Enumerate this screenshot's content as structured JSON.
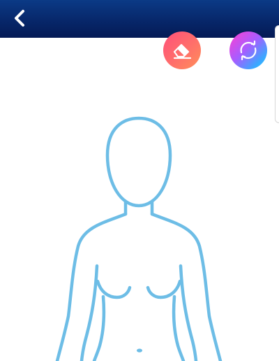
{
  "header": {
    "back_icon": "chevron-left-icon",
    "background": "#041a55"
  },
  "toolbar": {
    "eraser_icon": "eraser-icon",
    "reset_icon": "refresh-icon"
  },
  "figure": {
    "outline_color": "#6dbde6"
  }
}
